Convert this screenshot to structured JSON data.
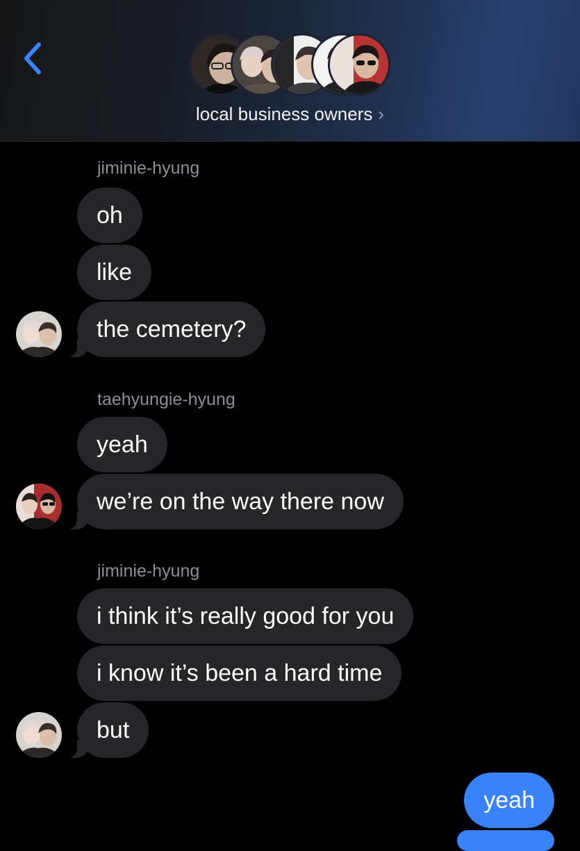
{
  "header": {
    "back_icon": "chevron-left-icon",
    "title": "local business owners",
    "title_chevron": "›",
    "accent": "#3a82f7",
    "avatars": [
      "avatar-1",
      "avatar-2",
      "avatar-3",
      "avatar-4",
      "avatar-5"
    ]
  },
  "messages": {
    "group1": {
      "sender": "jiminie-hyung",
      "bubbles": [
        "oh",
        "like",
        "the cemetery?"
      ]
    },
    "group2": {
      "sender": "taehyungie-hyung",
      "bubbles": [
        "yeah",
        "we’re on the way there now"
      ]
    },
    "group3": {
      "sender": "jiminie-hyung",
      "bubbles": [
        "i think it’s really good for you",
        "i know it’s been a hard time",
        "but"
      ]
    },
    "outgoing": {
      "bubbles": [
        "yeah"
      ],
      "color": "#3a82f7"
    }
  },
  "colors": {
    "incoming_bubble": "#262628",
    "sender_name": "#8e8e93",
    "background": "#000000"
  }
}
